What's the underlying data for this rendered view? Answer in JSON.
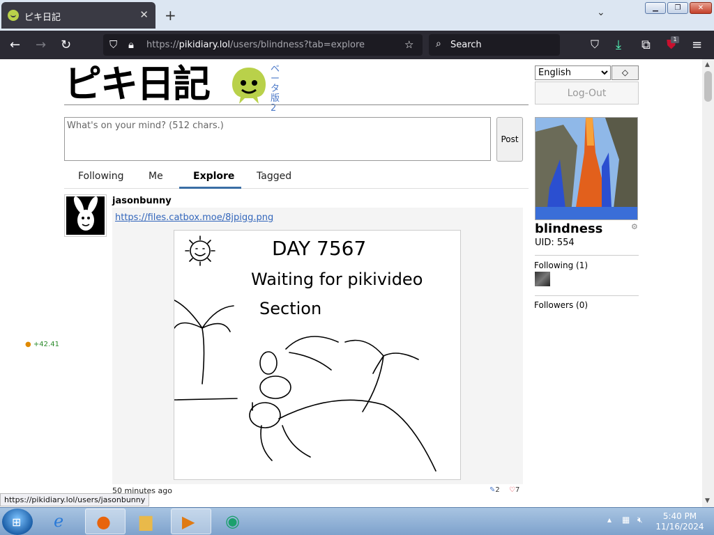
{
  "browser": {
    "tab_title": "ピキ日記",
    "tab_close": "✕",
    "new_tab": "+",
    "url_scheme": "https://",
    "url_host": "pikidiary.lol",
    "url_path": "/users/blindness?tab=explore",
    "search_placeholder": "Search",
    "extension_badge": "1"
  },
  "site": {
    "logo_text": "ピキ日記",
    "beta_label": "ベータ版2"
  },
  "header": {
    "language": "English",
    "language_options": [
      "English"
    ],
    "diamond_label": "◇",
    "logout_label": "Log-Out"
  },
  "composer": {
    "placeholder": "What's on your mind? (512 chars.)",
    "post_label": "Post"
  },
  "feed_tabs": [
    {
      "label": "Following"
    },
    {
      "label": "Me"
    },
    {
      "label": "Explore"
    },
    {
      "label": "Tagged"
    }
  ],
  "post": {
    "username": "jasonbunny",
    "link": "https://files.catbox.moe/8jpigg.png",
    "drawing_line1": "DAY 7567",
    "drawing_line2": "Waiting for pikivideo",
    "drawing_line3": "Section",
    "timestamp": "50 minutes ago",
    "comments": "2",
    "likes": "7"
  },
  "score": "+42.41",
  "profile": {
    "name": "blindness",
    "uid": "UID: 554",
    "following_label": "Following (1)",
    "followers_label": "Followers (0)"
  },
  "status_url": "https://pikidiary.lol/users/jasonbunny",
  "taskbar": {
    "time": "5:40 PM",
    "date": "11/16/2024"
  },
  "colors": {
    "accent_tab": "#3a6ea5",
    "logo_green": "#b9d14a",
    "link": "#3366bb"
  }
}
